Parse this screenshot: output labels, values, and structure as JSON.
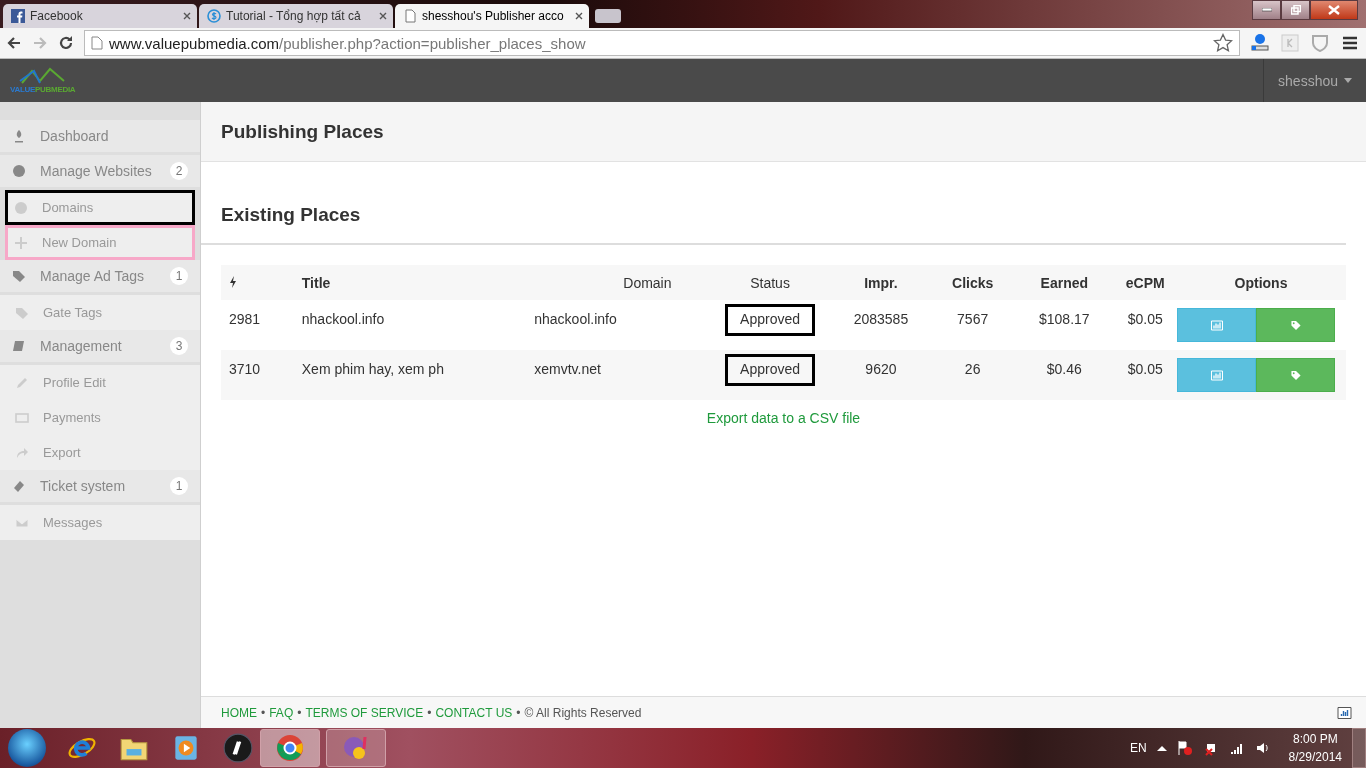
{
  "browser": {
    "tabs": [
      {
        "title": "Facebook",
        "selected": false
      },
      {
        "title": "Tutorial - Tổng hợp tất cả",
        "selected": false
      },
      {
        "title": "shesshou's Publisher acco",
        "selected": true
      }
    ],
    "url_host": "www.valuepubmedia.com",
    "url_path": "/publisher.php?action=publisher_places_show"
  },
  "header": {
    "logo_left": "VALUE",
    "logo_right": "PUBMEDIA",
    "user": "shesshou"
  },
  "sidebar": [
    {
      "label": "Dashboard"
    },
    {
      "label": "Manage Websites",
      "badge": "2",
      "children": [
        {
          "label": "Domains",
          "color": "#000000"
        },
        {
          "label": "New Domain",
          "color": "#f7a8c8"
        }
      ]
    },
    {
      "label": "Manage Ad Tags",
      "badge": "1",
      "children": [
        {
          "label": "Gate Tags"
        }
      ]
    },
    {
      "label": "Management",
      "badge": "3",
      "children": [
        {
          "label": "Profile Edit"
        },
        {
          "label": "Payments"
        },
        {
          "label": "Export"
        }
      ]
    },
    {
      "label": "Ticket system",
      "badge": "1",
      "children": [
        {
          "label": "Messages"
        }
      ]
    }
  ],
  "page_title": "Publishing Places",
  "section_title": "Existing Places",
  "table": {
    "columns": [
      "Title",
      "Domain",
      "Status",
      "Impr.",
      "Clicks",
      "Earned",
      "eCPM",
      "Options"
    ],
    "status_outlined": true,
    "rows": [
      {
        "id": "2981",
        "title": "nhackool.info",
        "domain": "nhackool.info",
        "status": "Approved",
        "impr": "2083585",
        "clicks": "7567",
        "earned": "$108.17",
        "ecpm": "$0.05"
      },
      {
        "id": "3710",
        "title": "Xem phim hay, xem ph",
        "domain": "xemvtv.net",
        "status": "Approved",
        "impr": "9620",
        "clicks": "26",
        "earned": "$0.46",
        "ecpm": "$0.05"
      }
    ]
  },
  "export_link": "Export data to a CSV file",
  "footer": {
    "items": [
      {
        "kind": "link",
        "text": "HOME"
      },
      {
        "kind": "separator",
        "text": "•"
      },
      {
        "kind": "link",
        "text": "FAQ"
      },
      {
        "kind": "separator",
        "text": "•"
      },
      {
        "kind": "link",
        "text": "TERMS OF SERVICE"
      },
      {
        "kind": "separator",
        "text": "•"
      },
      {
        "kind": "link",
        "text": "CONTACT US"
      },
      {
        "kind": "separator",
        "text": "•"
      },
      {
        "kind": "text",
        "text": "© All Rights Reserved"
      }
    ]
  },
  "taskbar": {
    "language": "EN",
    "time": "8:00 PM",
    "date": "8/29/2014"
  }
}
